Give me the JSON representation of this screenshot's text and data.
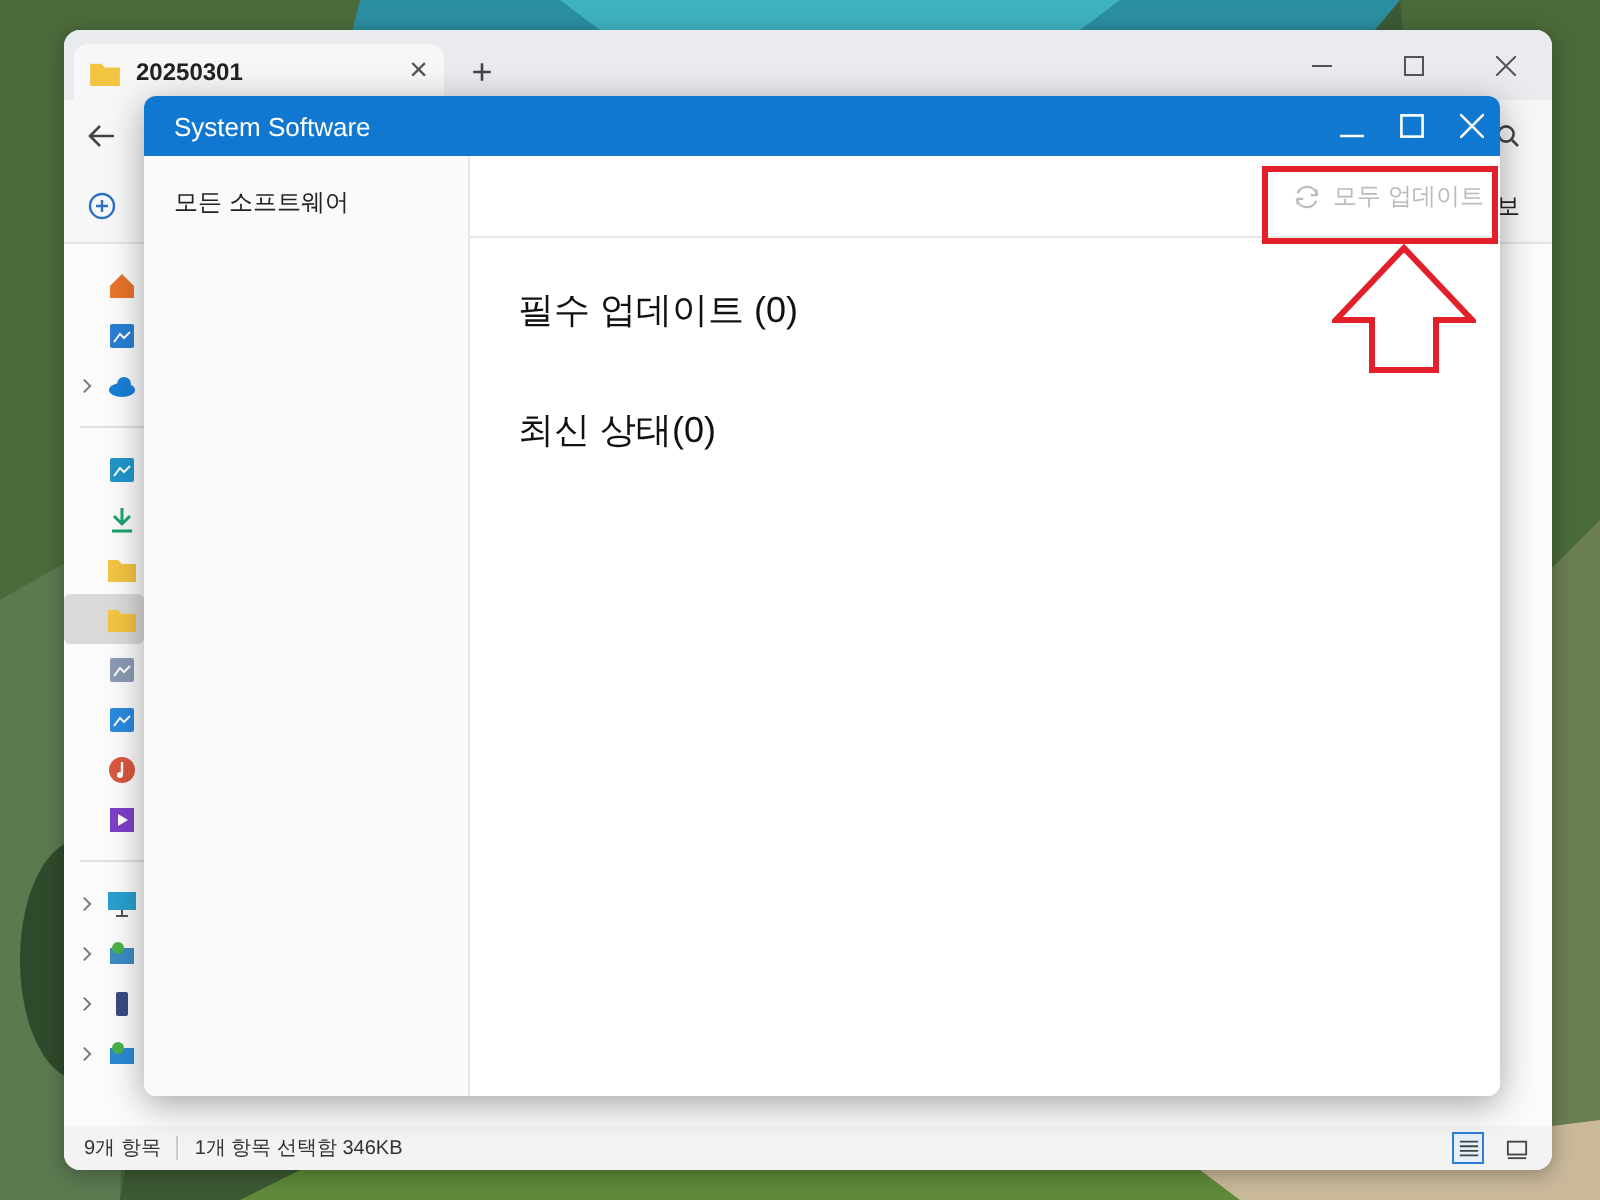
{
  "explorer": {
    "tab": {
      "title": "20250301",
      "close": "×"
    },
    "new_tab": "+",
    "command_bar": {
      "view_label": "보"
    },
    "sidebar": {
      "groups": [
        {
          "items": [
            {
              "kind": "home",
              "expandable": false,
              "selected": false
            },
            {
              "kind": "gallery",
              "expandable": false,
              "selected": false
            },
            {
              "kind": "cloud",
              "expandable": true,
              "selected": false
            }
          ]
        },
        {
          "items": [
            {
              "kind": "desktop",
              "expandable": false,
              "selected": false
            },
            {
              "kind": "downloads",
              "expandable": false,
              "selected": false
            },
            {
              "kind": "folder",
              "expandable": false,
              "selected": false
            },
            {
              "kind": "folder",
              "expandable": false,
              "selected": true
            },
            {
              "kind": "documents",
              "expandable": false,
              "selected": false
            },
            {
              "kind": "pictures",
              "expandable": false,
              "selected": false
            },
            {
              "kind": "music",
              "expandable": false,
              "selected": false
            },
            {
              "kind": "videos",
              "expandable": false,
              "selected": false
            }
          ]
        },
        {
          "items": [
            {
              "kind": "monitor",
              "expandable": true,
              "selected": false
            },
            {
              "kind": "network-drive",
              "expandable": true,
              "selected": false
            },
            {
              "kind": "drive",
              "expandable": true,
              "selected": false
            },
            {
              "kind": "network",
              "expandable": true,
              "selected": false
            }
          ]
        }
      ]
    },
    "status_bar": {
      "item_count": "9개 항목",
      "selection": "1개 항목 선택함 346KB"
    },
    "view_buttons": [
      {
        "kind": "details",
        "selected": true
      },
      {
        "kind": "tiles",
        "selected": false
      }
    ]
  },
  "dialog": {
    "title": "System Software",
    "nav": [
      {
        "label": "모든 소프트웨어",
        "selected": false
      }
    ],
    "toolbar": {
      "update_all": {
        "label": "모두 업데이트",
        "disabled": true
      }
    },
    "sections": [
      {
        "title": "필수 업데이트 (0)"
      },
      {
        "title": "최신 상태(0)"
      }
    ]
  }
}
